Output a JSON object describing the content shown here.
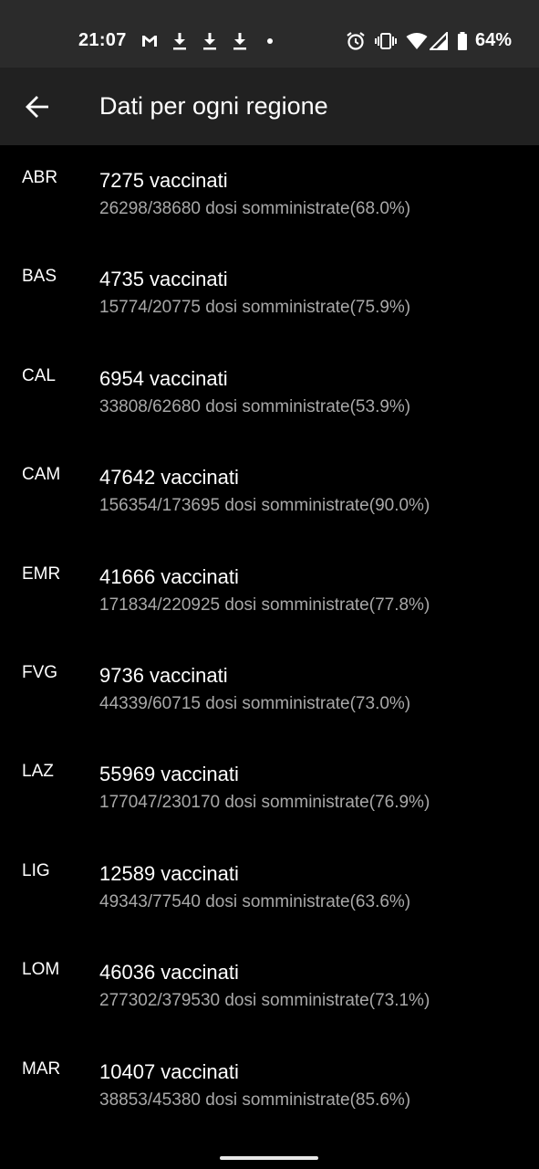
{
  "status_bar": {
    "time": "21:07",
    "battery_percent": "64%",
    "left_icons": [
      "gmail-icon",
      "download-icon",
      "download-icon",
      "download-icon",
      "dot-icon"
    ],
    "right_icons": [
      "alarm-icon",
      "vibrate-icon",
      "wifi-icon",
      "signal-icon",
      "battery-icon"
    ]
  },
  "app_bar": {
    "title": "Dati per ogni regione",
    "back_icon": "arrow-back-icon"
  },
  "regions": [
    {
      "code": "ABR",
      "vaccinated": "7275 vaccinati",
      "doses": "26298/38680 dosi somministrate(68.0%)"
    },
    {
      "code": "BAS",
      "vaccinated": "4735 vaccinati",
      "doses": "15774/20775 dosi somministrate(75.9%)"
    },
    {
      "code": "CAL",
      "vaccinated": "6954 vaccinati",
      "doses": "33808/62680 dosi somministrate(53.9%)"
    },
    {
      "code": "CAM",
      "vaccinated": "47642 vaccinati",
      "doses": "156354/173695 dosi somministrate(90.0%)"
    },
    {
      "code": "EMR",
      "vaccinated": "41666 vaccinati",
      "doses": "171834/220925 dosi somministrate(77.8%)"
    },
    {
      "code": "FVG",
      "vaccinated": "9736 vaccinati",
      "doses": "44339/60715 dosi somministrate(73.0%)"
    },
    {
      "code": "LAZ",
      "vaccinated": "55969 vaccinati",
      "doses": "177047/230170 dosi somministrate(76.9%)"
    },
    {
      "code": "LIG",
      "vaccinated": "12589 vaccinati",
      "doses": "49343/77540 dosi somministrate(63.6%)"
    },
    {
      "code": "LOM",
      "vaccinated": "46036 vaccinati",
      "doses": "277302/379530 dosi somministrate(73.1%)"
    },
    {
      "code": "MAR",
      "vaccinated": "10407 vaccinati",
      "doses": "38853/45380 dosi somministrate(85.6%)"
    }
  ]
}
